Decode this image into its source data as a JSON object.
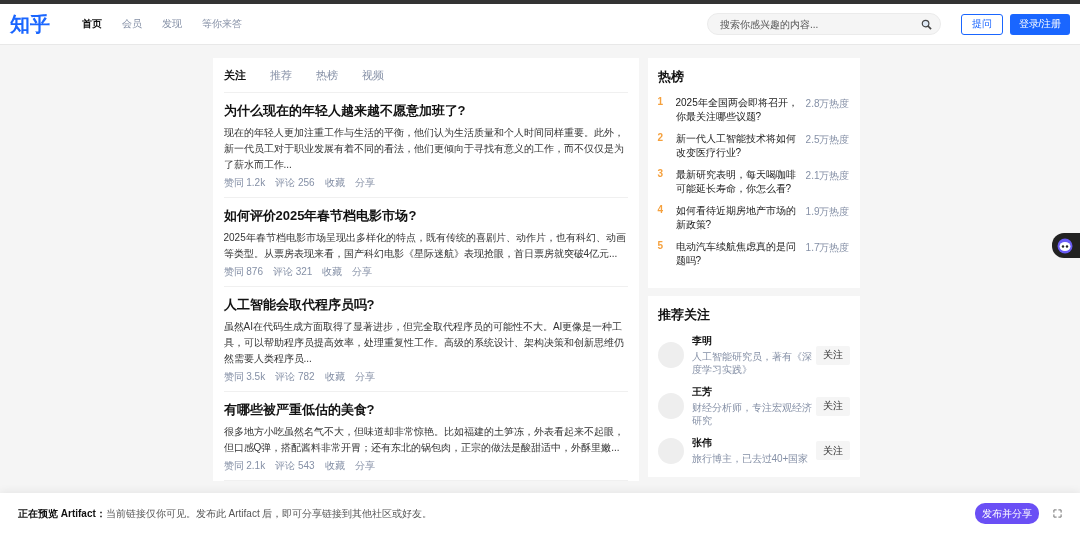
{
  "header": {
    "logo": "知乎",
    "nav": [
      {
        "label": "首页",
        "selected": true
      },
      {
        "label": "会员",
        "selected": false
      },
      {
        "label": "发现",
        "selected": false
      },
      {
        "label": "等你来答",
        "selected": false
      }
    ],
    "search": {
      "placeholder": "搜索你感兴趣的内容..."
    },
    "ask_button": "提问",
    "login_button": "登录/注册"
  },
  "feed": {
    "tabs": [
      {
        "label": "关注",
        "selected": true
      },
      {
        "label": "推荐",
        "selected": false
      },
      {
        "label": "热榜",
        "selected": false
      },
      {
        "label": "视频",
        "selected": false
      }
    ],
    "articles": [
      {
        "title": "为什么现在的年轻人越来越不愿意加班了?",
        "excerpt": "现在的年轻人更加注重工作与生活的平衡，他们认为生活质量和个人时间同样重要。此外，新一代员工对于职业发展有着不同的看法，他们更倾向于寻找有意义的工作，而不仅仅是为了薪水而工作...",
        "actions": [
          "赞同 1.2k",
          "评论 256",
          "收藏",
          "分享"
        ]
      },
      {
        "title": "如何评价2025年春节档电影市场?",
        "excerpt": "2025年春节档电影市场呈现出多样化的特点，既有传统的喜剧片、动作片，也有科幻、动画等类型。从票房表现来看，国产科幻电影《星际迷航》表现抢眼，首日票房就突破4亿元...",
        "actions": [
          "赞同 876",
          "评论 321",
          "收藏",
          "分享"
        ]
      },
      {
        "title": "人工智能会取代程序员吗?",
        "excerpt": "虽然AI在代码生成方面取得了显著进步，但完全取代程序员的可能性不大。AI更像是一种工具，可以帮助程序员提高效率，处理重复性工作。高级的系统设计、架构决策和创新思维仍然需要人类程序员...",
        "actions": [
          "赞同 3.5k",
          "评论 782",
          "收藏",
          "分享"
        ]
      },
      {
        "title": "有哪些被严重低估的美食?",
        "excerpt": "很多地方小吃虽然名气不大，但味道却非常惊艳。比如福建的土笋冻，外表看起来不起眼，但口感Q弹，搭配酱料非常开胃；还有东北的锅包肉，正宗的做法是酸甜适中，外酥里嫩...",
        "actions": [
          "赞同 2.1k",
          "评论 543",
          "收藏",
          "分享"
        ]
      }
    ]
  },
  "hot_list": {
    "title": "热榜",
    "items": [
      {
        "rank": "1",
        "title": "2025年全国两会即将召开，你最关注哪些议题?",
        "heat": "2.8万热度"
      },
      {
        "rank": "2",
        "title": "新一代人工智能技术将如何改变医疗行业?",
        "heat": "2.5万热度"
      },
      {
        "rank": "3",
        "title": "最新研究表明，每天喝咖啡可能延长寿命，你怎么看?",
        "heat": "2.1万热度"
      },
      {
        "rank": "4",
        "title": "如何看待近期房地产市场的新政策?",
        "heat": "1.9万热度"
      },
      {
        "rank": "5",
        "title": "电动汽车续航焦虑真的是问题吗?",
        "heat": "1.7万热度"
      }
    ]
  },
  "recommended": {
    "title": "推荐关注",
    "users": [
      {
        "name": "李明",
        "bio": "人工智能研究员，著有《深度学习实践》",
        "follow": "关注"
      },
      {
        "name": "王芳",
        "bio": "财经分析师，专注宏观经济研究",
        "follow": "关注"
      },
      {
        "name": "张伟",
        "bio": "旅行博主，已去过40+国家",
        "follow": "关注"
      }
    ]
  },
  "preview_bar": {
    "label": "正在预览 Artifact：",
    "message": "当前链接仅你可见。发布此 Artifact 后，即可分享链接到其他社区或好友。",
    "publish_button": "发布并分享"
  }
}
